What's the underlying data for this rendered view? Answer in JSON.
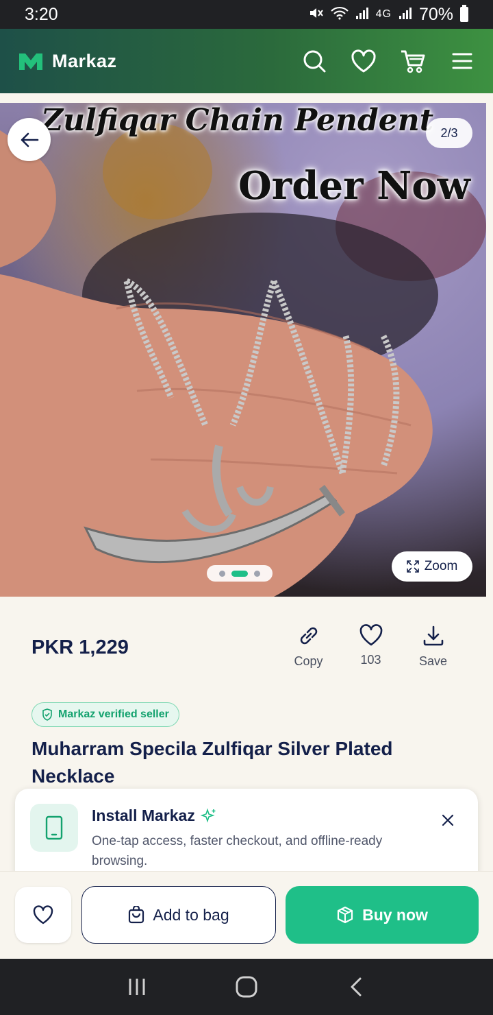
{
  "status_bar": {
    "time": "3:20",
    "network": "4G",
    "battery": "70%"
  },
  "header": {
    "brand": "Markaz",
    "brand_color": "#23c07b",
    "icons": [
      "search-icon",
      "heart-icon",
      "cart-icon",
      "menu-icon"
    ]
  },
  "gallery": {
    "overlay_title": "Zulfiqar Chain Pendent",
    "overlay_cta": "Order Now",
    "counter": "2/3",
    "zoom_label": "Zoom",
    "active_index": 2,
    "total_images": 3
  },
  "product": {
    "price": "PKR 1,229",
    "actions": [
      {
        "icon": "link-icon",
        "label": "Copy"
      },
      {
        "icon": "heart-icon",
        "label": "103"
      },
      {
        "icon": "download-icon",
        "label": "Save"
      }
    ],
    "verified_badge": "Markaz verified seller",
    "title": "Muharram Specila Zulfiqar Silver Plated Necklace"
  },
  "install_banner": {
    "title": "Install Markaz",
    "description": "One-tap access, faster checkout, and offline-ready browsing."
  },
  "bottom_bar": {
    "add_to_bag": "Add to bag",
    "buy_now": "Buy now",
    "accent_color": "#1fbf88"
  }
}
